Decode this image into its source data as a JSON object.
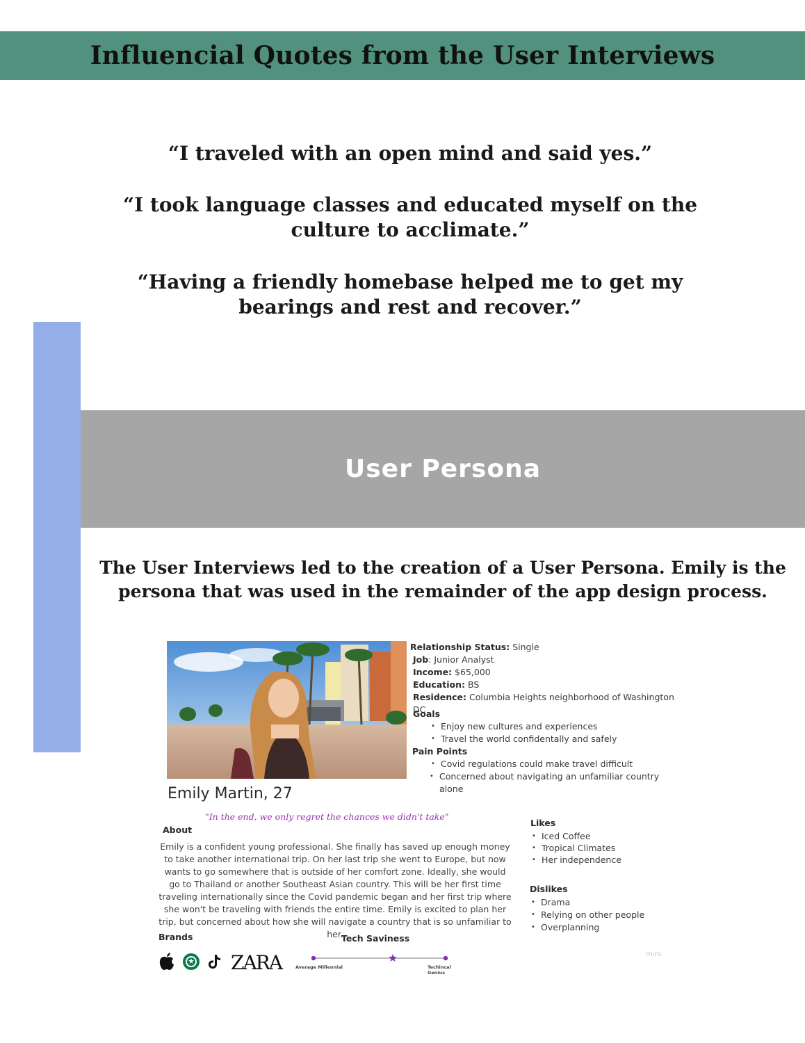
{
  "header": {
    "title": "Influencial Quotes from the User Interviews"
  },
  "quotes": [
    "“I traveled with an open mind and said yes.”",
    "“I took language classes and educated myself on the culture to acclimate.”",
    "“Having a friendly homebase helped me to get my bearings and rest and recover.”"
  ],
  "persona_section": {
    "title": "User Persona"
  },
  "intro": "The User Interviews led to the creation of a User Persona. Emily is the persona that was used in the remainder of the app design process.",
  "persona": {
    "facts": [
      {
        "label": "Relationship Status:",
        "value": " Single"
      },
      {
        "label": "Job",
        "value": ": Junior Analyst"
      },
      {
        "label": "Income:",
        "value": " $65,000"
      },
      {
        "label": "Education:",
        "value": " BS"
      },
      {
        "label": "Residence:",
        "value": " Columbia Heights neighborhood of Washington DC"
      }
    ],
    "goals_title": "Goals",
    "goals": [
      "Enjoy new cultures and experiences",
      "Travel the world confidentally and safely"
    ],
    "pain_points_title": "Pain Points",
    "pain_points": [
      "Covid regulations could make travel difficult",
      "Concerned about navigating an unfamiliar country alone"
    ],
    "name": "Emily Martin, 27",
    "motto": "\"In the end, we only regret the chances we didn't take\"",
    "about_title": "About",
    "about": "Emily is a confident young professional. She finally has saved up enough money to take another international trip. On her last trip she went to Europe, but now wants to go somewhere that is outside of her comfort zone.  Ideally, she would go to Thailand or another Southeast Asian country. This will be her first time traveling internationally since the Covid pandemic began and her first trip where she won't be traveling with friends the entire time. Emily is excited to plan her trip, but concerned about how she will navigate a country that is so unfamiliar to her.",
    "likes_title": "Likes",
    "likes": [
      "Iced Coffee",
      "Tropical Climates",
      "Her independence"
    ],
    "dislikes_title": "Dislikes",
    "dislikes": [
      "Drama",
      "Relying on other people",
      "Overplanning"
    ],
    "brands_title": "Brands",
    "brands": {
      "icons": [
        "apple-icon",
        "starbucks-icon",
        "tiktok-icon"
      ],
      "zara_logo": "ZARA"
    },
    "tech": {
      "title": "Tech Saviness",
      "low_label": "Average Millennial",
      "high_label": "Techincal Genius",
      "level": 0.6,
      "color": "#8a2bb8"
    },
    "watermark": "miro"
  },
  "colors": {
    "banner": "#52917d",
    "sidebar": "#93aee8",
    "persona_banner": "#a6a6a6",
    "motto": "#9b2fb3"
  }
}
